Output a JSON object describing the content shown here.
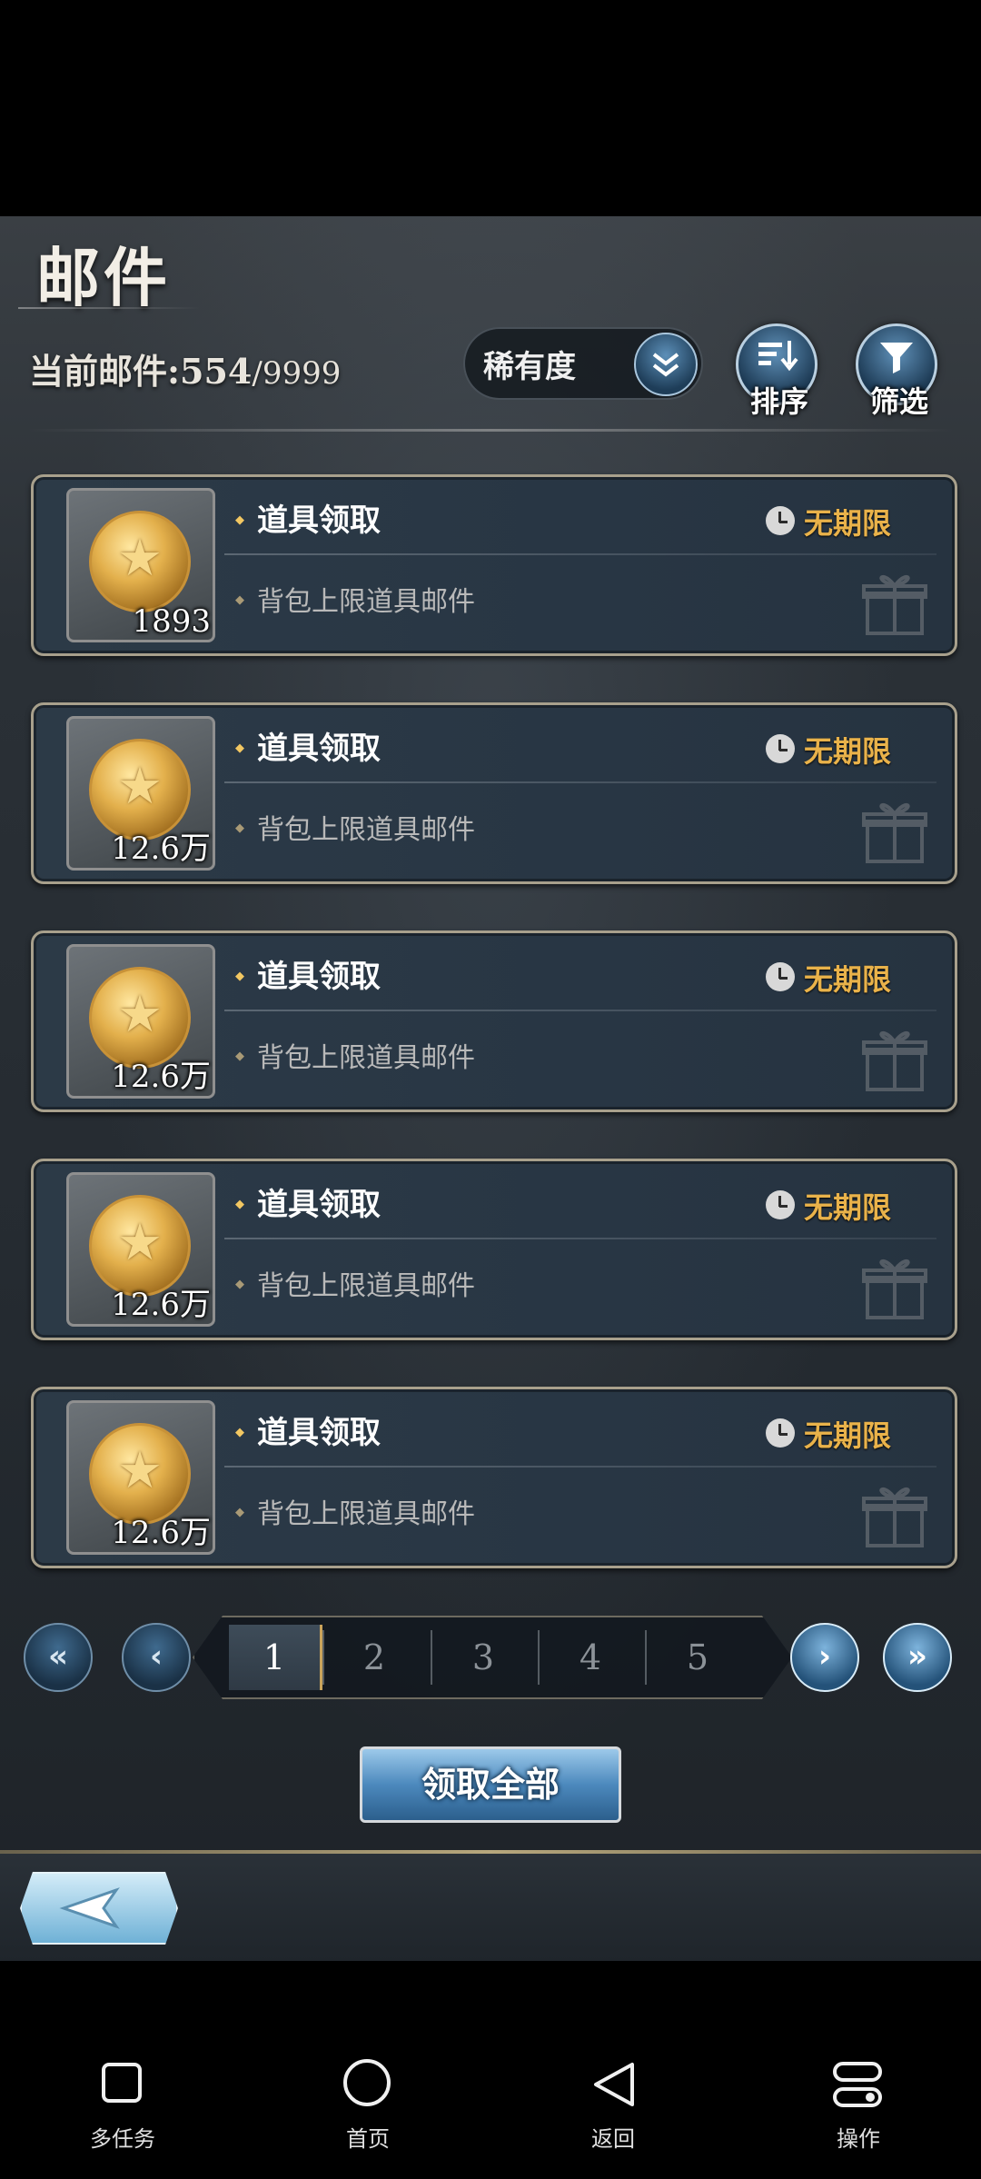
{
  "header": {
    "title": "邮件",
    "mail_count_label": "当前邮件:",
    "mail_count_current": "554",
    "mail_count_max": "/9999"
  },
  "toolbar": {
    "rarity_label": "稀有度",
    "sort_label": "排序",
    "filter_label": "筛选"
  },
  "mails": [
    {
      "title": "道具领取",
      "subtitle": "背包上限道具邮件",
      "expire": "无期限",
      "quantity": "1893"
    },
    {
      "title": "道具领取",
      "subtitle": "背包上限道具邮件",
      "expire": "无期限",
      "quantity": "12.6万"
    },
    {
      "title": "道具领取",
      "subtitle": "背包上限道具邮件",
      "expire": "无期限",
      "quantity": "12.6万"
    },
    {
      "title": "道具领取",
      "subtitle": "背包上限道具邮件",
      "expire": "无期限",
      "quantity": "12.6万"
    },
    {
      "title": "道具领取",
      "subtitle": "背包上限道具邮件",
      "expire": "无期限",
      "quantity": "12.6万"
    }
  ],
  "pagination": {
    "pages": [
      "1",
      "2",
      "3",
      "4",
      "5"
    ],
    "current": "1"
  },
  "actions": {
    "claim_all": "领取全部"
  },
  "navbar": {
    "multitask": "多任务",
    "home": "首页",
    "back": "返回",
    "operate": "操作"
  },
  "colors": {
    "accent_gold": "#e9b24a",
    "button_blue": "#4c89bd"
  }
}
